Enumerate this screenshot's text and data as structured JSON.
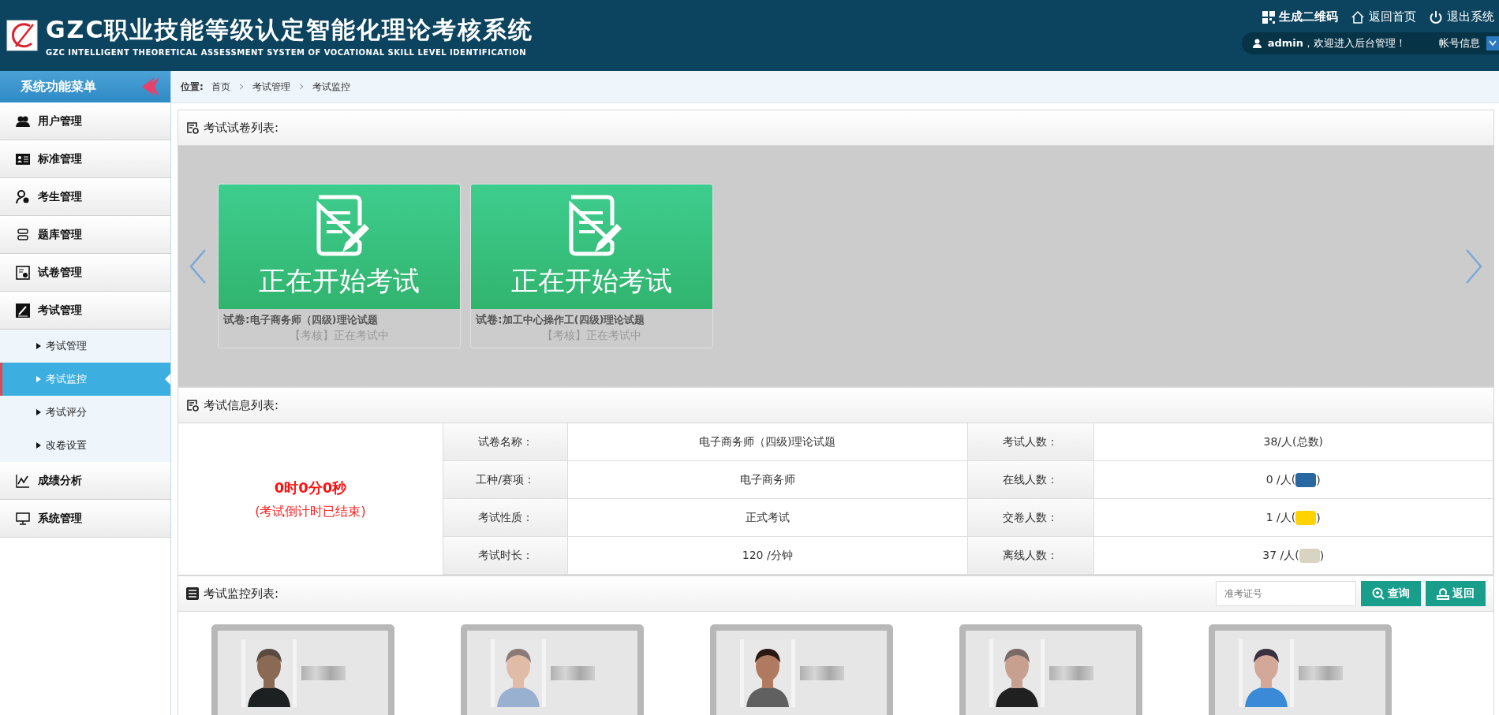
{
  "header": {
    "title": "GZC职业技能等级认定智能化理论考核系统",
    "subtitle": "GZC INTELLIGENT THEORETICAL ASSESSMENT SYSTEM OF VOCATIONAL SKILL LEVEL IDENTIFICATION",
    "actions": [
      {
        "label": "生成二维码"
      },
      {
        "label": "返回首页"
      },
      {
        "label": "退出系统"
      }
    ],
    "welcome": "**admin**，欢迎进入后台管理！",
    "account": "帐号信息"
  },
  "sidebar": {
    "title": "系统功能菜单",
    "items": [
      {
        "label": "用户管理"
      },
      {
        "label": "标准管理"
      },
      {
        "label": "考生管理"
      },
      {
        "label": "题库管理"
      },
      {
        "label": "试卷管理"
      },
      {
        "label": "考试管理",
        "children": [
          {
            "label": "考试管理",
            "selected": false
          },
          {
            "label": "考试监控",
            "selected": true
          },
          {
            "label": "考试评分",
            "selected": false
          },
          {
            "label": "改卷设置",
            "selected": false
          }
        ]
      },
      {
        "label": "成绩分析"
      },
      {
        "label": "系统管理"
      }
    ]
  },
  "breadcrumb": {
    "label": "位置:",
    "path": [
      "首页",
      "考试管理",
      "考试监控"
    ]
  },
  "papers_panel": {
    "title": "考试试卷列表:",
    "papers": [
      {
        "banner": "正在开始考试",
        "paper_label": "试卷:",
        "paper_name": "电子商务师（四级)理论试题",
        "status": "【考核】正在考试中"
      },
      {
        "banner": "正在开始考试",
        "paper_label": "试卷:",
        "paper_name": "加工中心操作工(四级)理论试题",
        "status": "【考核】正在考试中"
      }
    ]
  },
  "info_panel": {
    "title": "考试信息列表:",
    "countdown": "0时0分0秒",
    "countdown_note": "(考试倒计时已结束)",
    "rows": [
      {
        "label": "试卷名称：",
        "value": "电子商务师（四级)理论试题",
        "label_2": "考试人数：",
        "value_2": "38/人(总数)"
      },
      {
        "label": "工种/赛项：",
        "value": "电子商务师",
        "label_2": "在线人数：",
        "value_2": "0 /人(",
        "value_2_end": ")",
        "color": "#28679f"
      },
      {
        "label": "考试性质：",
        "value": "正式考试",
        "label_2": "交卷人数：",
        "value_2": "1 /人(",
        "value_2_end": ")",
        "color": "#ffd200"
      },
      {
        "label": "考试时长：",
        "value": "120 /分钟",
        "label_2": "离线人数：",
        "value_2": "37 /人(",
        "value_2_end": ")",
        "color": "#d8d4c2"
      }
    ]
  },
  "monitor_panel": {
    "title": "考试监控列表:",
    "search": {
      "placeholder": "准考证号"
    },
    "buttons": [
      {
        "label": "查询"
      },
      {
        "label": "返回"
      }
    ]
  }
}
